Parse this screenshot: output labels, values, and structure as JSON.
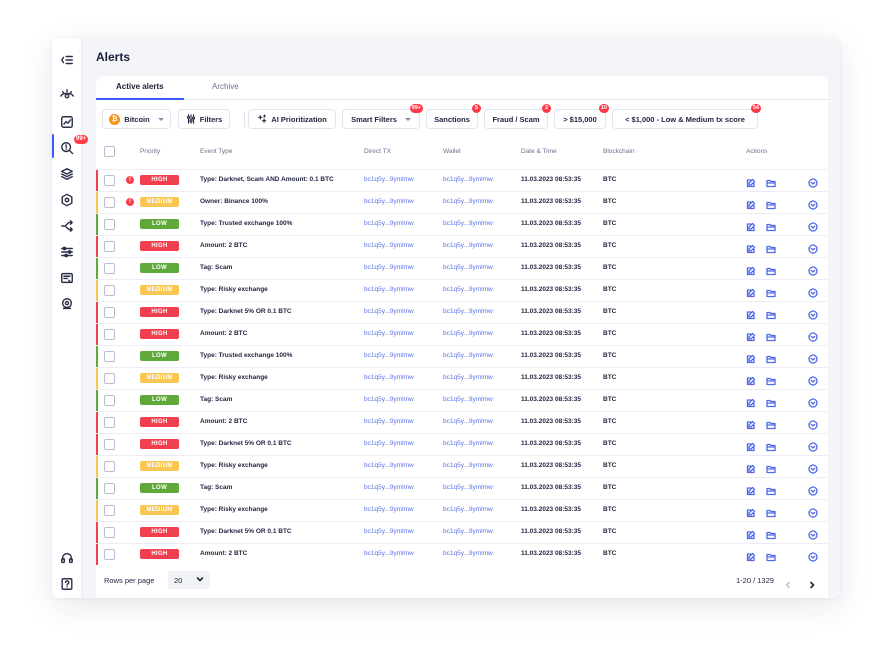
{
  "page_title": "Alerts",
  "tabs": [
    {
      "label": "Active alerts",
      "active": true
    },
    {
      "label": "Archive",
      "active": false
    }
  ],
  "sidebar": {
    "alerts_badge": "99+",
    "items": [
      "collapse-menu-icon",
      "eye-icon",
      "trend-chart-icon",
      "alerts-search-icon",
      "layers-icon",
      "gear-shield-icon",
      "split-arrows-icon",
      "sliders-icon",
      "report-icon",
      "settings-cloud-icon",
      "support-headset-icon",
      "help-icon"
    ]
  },
  "toolbar": {
    "network_label": "Bitcoin",
    "network_symbol": "₿",
    "filters_label": "Filters",
    "ai_label": "AI Prioritization",
    "smart_filters_label": "Smart Filters",
    "smart_filters_badge": "99+",
    "sanctions_label": "Sanctions",
    "sanctions_badge": "5",
    "fraud_label": "Fraud / Scam",
    "fraud_badge": "2",
    "over_label": "> $15,000",
    "over_badge": "10",
    "under_label": "< $1,000 - Low & Medium tx score",
    "under_badge": "54"
  },
  "columns": {
    "priority": "Priority",
    "event_type": "Event Type",
    "direct_tx": "Direct TX",
    "wallet": "Wallet",
    "date_time": "Date & Time",
    "blockchain": "Blockchain",
    "actions": "Actions"
  },
  "priority_colors": {
    "HIGH": "#f23f4f",
    "MEDIUM": "#f7c654",
    "LOW": "#5fa83a"
  },
  "rows": [
    {
      "priority": "HIGH",
      "flag": true,
      "event": "Type: Darknet, Scam AND Amount: 0.1 BTC",
      "tx": "bc1q5y...9ymlmw",
      "wallet": "bc1q5y...9ymlmw",
      "date": "11.03.2023 08:53:35",
      "chain": "BTC"
    },
    {
      "priority": "MEDIUM",
      "flag": true,
      "event": "Owner: Binance 100%",
      "tx": "bc1q5y...9ymlmw",
      "wallet": "bc1q5y...9ymlmw",
      "date": "11.03.2023 08:53:35",
      "chain": "BTC"
    },
    {
      "priority": "LOW",
      "flag": false,
      "event": "Type: Trusted exchange 100%",
      "tx": "bc1q5y...9ymlmw",
      "wallet": "bc1q5y...9ymlmw",
      "date": "11.03.2023 08:53:35",
      "chain": "BTC"
    },
    {
      "priority": "HIGH",
      "flag": false,
      "event": "Amount: 2 BTC",
      "tx": "bc1q5y...9ymlmw",
      "wallet": "bc1q5y...9ymlmw",
      "date": "11.03.2023 08:53:35",
      "chain": "BTC"
    },
    {
      "priority": "LOW",
      "flag": false,
      "event": "Tag: Scam",
      "tx": "bc1q5y...9ymlmw",
      "wallet": "bc1q5y...9ymlmw",
      "date": "11.03.2023 08:53:35",
      "chain": "BTC"
    },
    {
      "priority": "MEDIUM",
      "flag": false,
      "event": "Type: Risky exchange",
      "tx": "bc1q5y...9ymlmw",
      "wallet": "bc1q5y...9ymlmw",
      "date": "11.03.2023 08:53:35",
      "chain": "BTC"
    },
    {
      "priority": "HIGH",
      "flag": false,
      "event": "Type: Darknet 5% OR 0.1 BTC",
      "tx": "bc1q5y...9ymlmw",
      "wallet": "bc1q5y...9ymlmw",
      "date": "11.03.2023 08:53:35",
      "chain": "BTC"
    },
    {
      "priority": "HIGH",
      "flag": false,
      "event": "Amount: 2 BTC",
      "tx": "bc1q5y...9ymlmw",
      "wallet": "bc1q5y...9ymlmw",
      "date": "11.03.2023 08:53:35",
      "chain": "BTC"
    },
    {
      "priority": "LOW",
      "flag": false,
      "event": "Type: Trusted exchange 100%",
      "tx": "bc1q5y...9ymlmw",
      "wallet": "bc1q5y...9ymlmw",
      "date": "11.03.2023 08:53:35",
      "chain": "BTC"
    },
    {
      "priority": "MEDIUM",
      "flag": false,
      "event": "Type: Risky exchange",
      "tx": "bc1q5y...9ymlmw",
      "wallet": "bc1q5y...9ymlmw",
      "date": "11.03.2023 08:53:35",
      "chain": "BTC"
    },
    {
      "priority": "LOW",
      "flag": false,
      "event": "Tag: Scam",
      "tx": "bc1q5y...9ymlmw",
      "wallet": "bc1q5y...9ymlmw",
      "date": "11.03.2023 08:53:35",
      "chain": "BTC"
    },
    {
      "priority": "HIGH",
      "flag": false,
      "event": "Amount: 2 BTC",
      "tx": "bc1q5y...9ymlmw",
      "wallet": "bc1q5y...9ymlmw",
      "date": "11.03.2023 08:53:35",
      "chain": "BTC"
    },
    {
      "priority": "HIGH",
      "flag": false,
      "event": "Type: Darknet 5% OR 0.1 BTC",
      "tx": "bc1q5y...9ymlmw",
      "wallet": "bc1q5y...9ymlmw",
      "date": "11.03.2023 08:53:35",
      "chain": "BTC"
    },
    {
      "priority": "MEDIUM",
      "flag": false,
      "event": "Type: Risky exchange",
      "tx": "bc1q5y...9ymlmw",
      "wallet": "bc1q5y...9ymlmw",
      "date": "11.03.2023 08:53:35",
      "chain": "BTC"
    },
    {
      "priority": "LOW",
      "flag": false,
      "event": "Tag: Scam",
      "tx": "bc1q5y...9ymlmw",
      "wallet": "bc1q5y...9ymlmw",
      "date": "11.03.2023 08:53:35",
      "chain": "BTC"
    },
    {
      "priority": "MEDIUM",
      "flag": false,
      "event": "Type: Risky exchange",
      "tx": "bc1q5y...9ymlmw",
      "wallet": "bc1q5y...9ymlmw",
      "date": "11.03.2023 08:53:35",
      "chain": "BTC"
    },
    {
      "priority": "HIGH",
      "flag": false,
      "event": "Type: Darknet 5% OR 0.1 BTC",
      "tx": "bc1q5y...9ymlmw",
      "wallet": "bc1q5y...9ymlmw",
      "date": "11.03.2023 08:53:35",
      "chain": "BTC"
    },
    {
      "priority": "HIGH",
      "flag": false,
      "event": "Amount: 2 BTC",
      "tx": "bc1q5y...9ymlmw",
      "wallet": "bc1q5y...9ymlmw",
      "date": "11.03.2023 08:53:35",
      "chain": "BTC"
    }
  ],
  "footer": {
    "rows_per_page_label": "Rows per page",
    "rows_per_page_value": "20",
    "range": "1-20 / 1329"
  }
}
